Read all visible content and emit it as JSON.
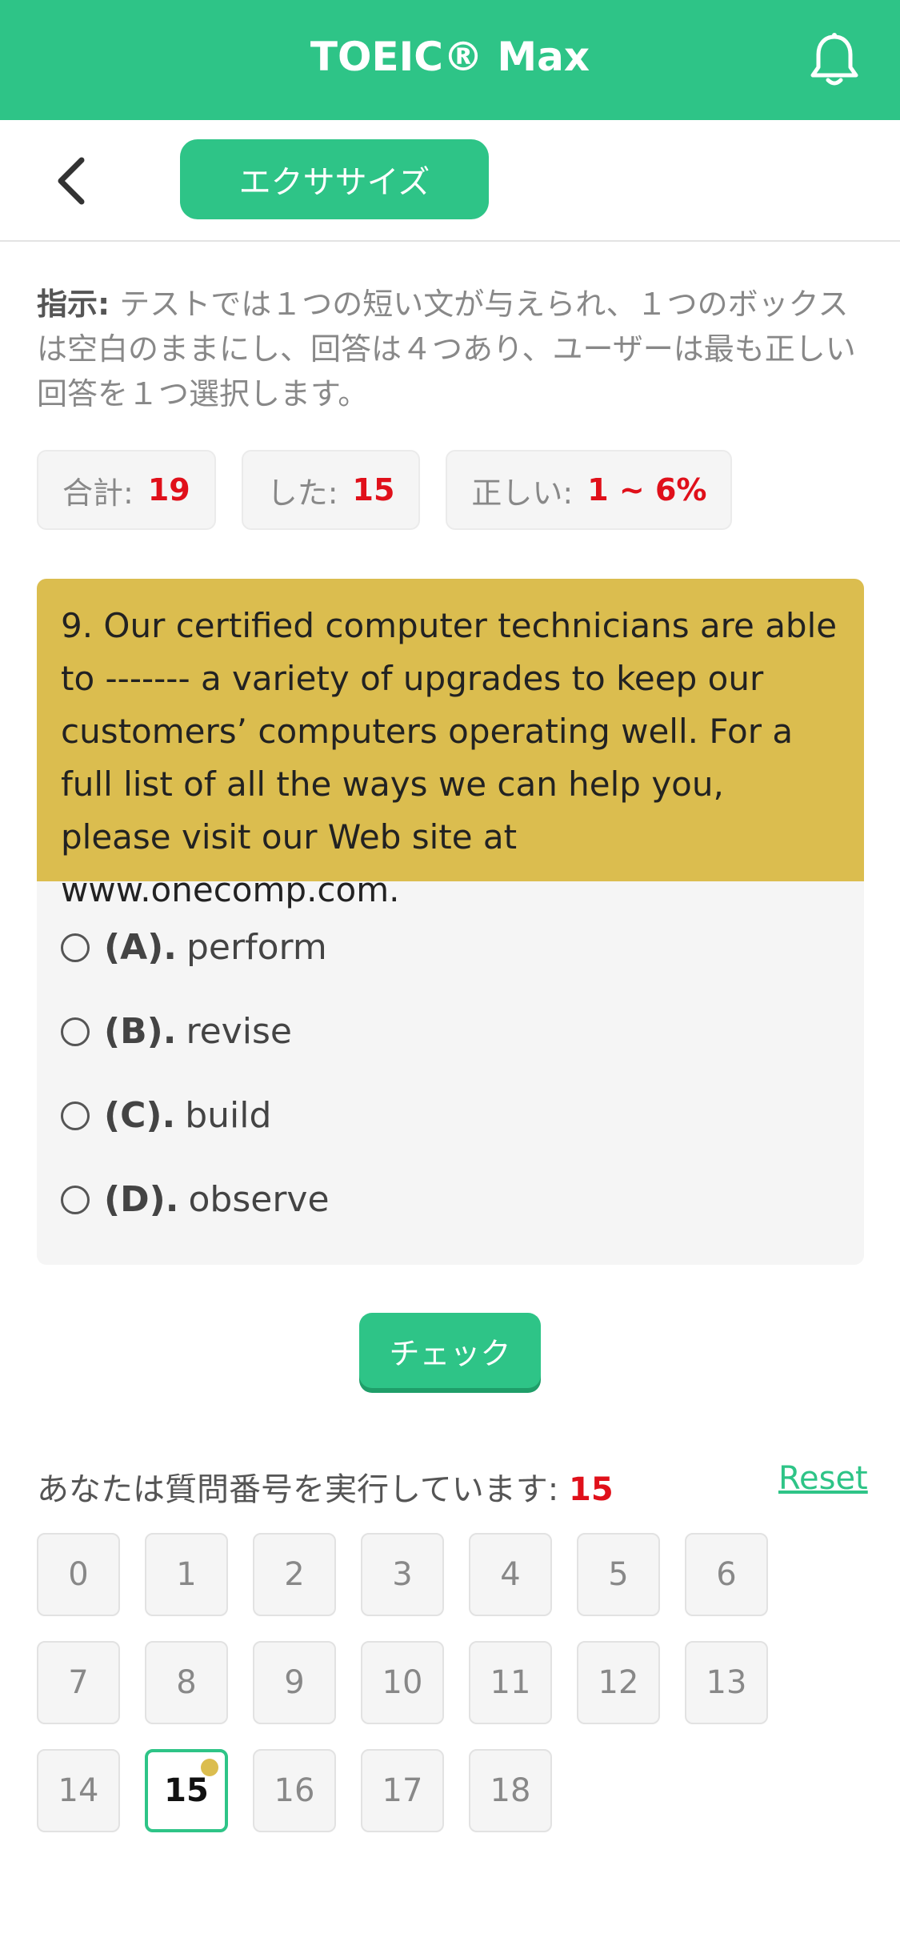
{
  "header": {
    "title": "TOEIC® Max",
    "icon": "bell-icon"
  },
  "subbar": {
    "back_icon": "chevron-left-icon",
    "tab_label": "エクササイズ"
  },
  "instructions": {
    "label": "指示:",
    "text": " テストでは１つの短い文が与えられ、１つのボックスは空白のままにし、回答は４つあり、ユーザーは最も正しい回答を１つ選択します。"
  },
  "stats": [
    {
      "label": "合計:",
      "value": "19"
    },
    {
      "label": "した:",
      "value": "15"
    },
    {
      "label": "正しい:",
      "value": "1 ~ 6%"
    }
  ],
  "question": {
    "text": "9. Our certified computer technicians are able to ------- a variety of upgrades to keep our customers’ computers operating well. For a full list of all the ways we can help you, please visit our Web site at www.onecomp.com.",
    "options": [
      {
        "letter": "(A).",
        "text": "perform"
      },
      {
        "letter": "(B).",
        "text": "revise"
      },
      {
        "letter": "(C).",
        "text": "build"
      },
      {
        "letter": "(D).",
        "text": "observe"
      }
    ]
  },
  "check_label": "チェック",
  "progress": {
    "label": "あなたは質問番号を実行しています:",
    "current": "15",
    "reset_label": "Reset"
  },
  "question_numbers": [
    "0",
    "1",
    "2",
    "3",
    "4",
    "5",
    "6",
    "7",
    "8",
    "9",
    "10",
    "11",
    "12",
    "13",
    "14",
    "15",
    "16",
    "17",
    "18"
  ],
  "colors": {
    "brand": "#2ec487",
    "question_bg": "#dbbd4f",
    "highlight": "#e0101a"
  }
}
